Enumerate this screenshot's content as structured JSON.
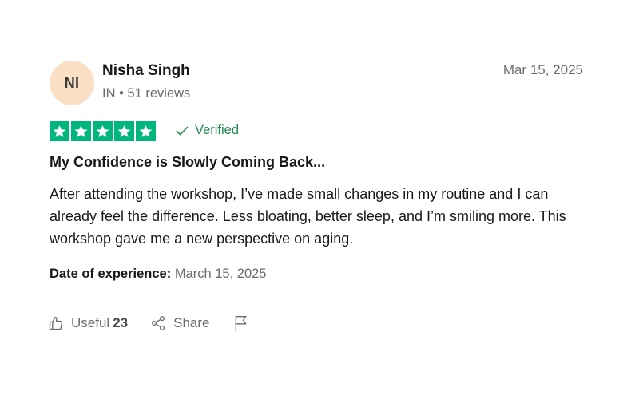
{
  "review": {
    "author_initials": "NI",
    "author_name": "Nisha Singh",
    "author_meta": "IN • 51 reviews",
    "date": "Mar 15, 2025",
    "rating": 5,
    "verified_label": "Verified",
    "title": "My Confidence is Slowly Coming Back...",
    "body": "After attending the workshop, I’ve made small changes in my routine and I can already feel the difference. Less bloating, better sleep, and I’m smiling more. This workshop gave me a new perspective on aging.",
    "date_of_experience_label": "Date of experience:",
    "date_of_experience_value": "March 15, 2025"
  },
  "actions": {
    "useful_label": "Useful",
    "useful_count": "23",
    "share_label": "Share",
    "useful_icon": "thumbs-up-icon",
    "share_icon": "share-icon",
    "report_icon": "flag-icon"
  },
  "colors": {
    "star_green": "#00b67a",
    "verified_green": "#1f8b4c",
    "avatar_bg": "#fbe0c5",
    "muted_text": "#6b6b6b"
  }
}
